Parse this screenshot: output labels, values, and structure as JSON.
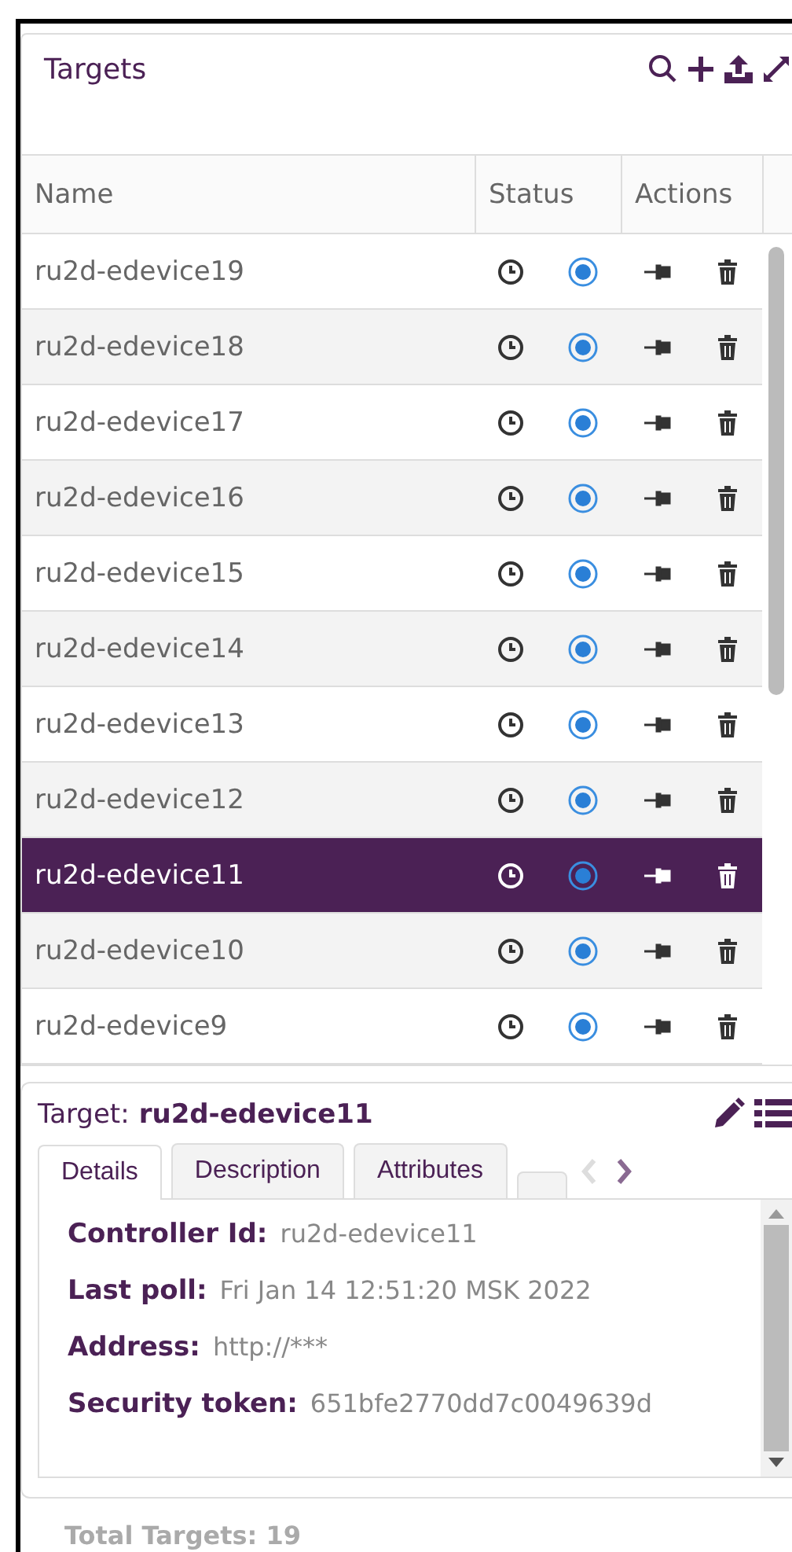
{
  "panel": {
    "title": "Targets"
  },
  "table": {
    "columns": [
      "Name",
      "Status",
      "Actions"
    ],
    "rows": [
      {
        "name": "ru2d-edevice19",
        "selected": false
      },
      {
        "name": "ru2d-edevice18",
        "selected": false
      },
      {
        "name": "ru2d-edevice17",
        "selected": false
      },
      {
        "name": "ru2d-edevice16",
        "selected": false
      },
      {
        "name": "ru2d-edevice15",
        "selected": false
      },
      {
        "name": "ru2d-edevice14",
        "selected": false
      },
      {
        "name": "ru2d-edevice13",
        "selected": false
      },
      {
        "name": "ru2d-edevice12",
        "selected": false
      },
      {
        "name": "ru2d-edevice11",
        "selected": true
      },
      {
        "name": "ru2d-edevice10",
        "selected": false
      },
      {
        "name": "ru2d-edevice9",
        "selected": false
      }
    ]
  },
  "details": {
    "label": "Target:",
    "name": "ru2d-edevice11",
    "tabs": [
      {
        "label": "Details",
        "selected": true
      },
      {
        "label": "Description",
        "selected": false
      },
      {
        "label": "Attributes",
        "selected": false
      }
    ],
    "prev_disabled": true,
    "next_disabled": false,
    "fields": [
      {
        "label": "Controller Id:",
        "value": "ru2d-edevice11"
      },
      {
        "label": "Last poll:",
        "value": "Fri Jan 14 12:51:20 MSK 2022"
      },
      {
        "label": "Address:",
        "value": "http://***"
      },
      {
        "label": "Security token:",
        "value": "651bfe2770dd7c0049639d"
      }
    ]
  },
  "footer": {
    "total": "Total Targets: 19"
  }
}
